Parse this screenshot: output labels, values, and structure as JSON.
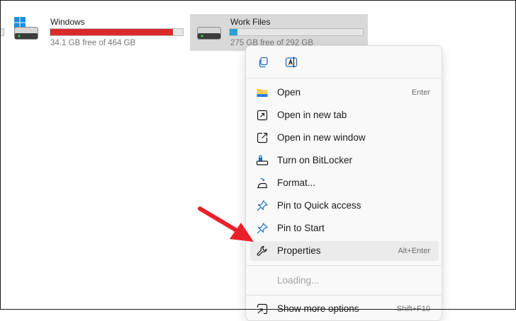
{
  "drives": [
    {
      "name": "Windows",
      "free_text": "34.1 GB free of 464 GB",
      "used_fraction": 0.926,
      "bar_color": "#da2a2a",
      "icon": "windows-hdd-icon"
    },
    {
      "name": "Work Files",
      "free_text": "275 GB free of 292 GB",
      "used_fraction": 0.06,
      "bar_color": "#26a0da",
      "icon": "hdd-icon",
      "selected": true
    }
  ],
  "context_menu": {
    "quick_actions": [
      {
        "icon": "copy-icon",
        "name": "copy"
      },
      {
        "icon": "rename-icon",
        "name": "rename"
      }
    ],
    "items": [
      {
        "label": "Open",
        "shortcut": "Enter",
        "icon": "folder-icon"
      },
      {
        "label": "Open in new tab",
        "icon": "open-new-tab-icon"
      },
      {
        "label": "Open in new window",
        "icon": "open-new-window-icon"
      },
      {
        "label": "Turn on BitLocker",
        "icon": "bitlocker-icon"
      },
      {
        "label": "Format...",
        "icon": "format-icon"
      },
      {
        "label": "Pin to Quick access",
        "icon": "pin-icon"
      },
      {
        "label": "Pin to Start",
        "icon": "pin-icon"
      },
      {
        "label": "Properties",
        "shortcut": "Alt+Enter",
        "icon": "wrench-icon",
        "highlighted": true
      },
      {
        "label": "Loading...",
        "disabled": true
      },
      {
        "label": "Show more options",
        "shortcut": "Shift+F10",
        "icon": "more-options-icon"
      }
    ]
  },
  "annotation": {
    "color": "#e8202a",
    "icon": "red-arrow-icon"
  }
}
